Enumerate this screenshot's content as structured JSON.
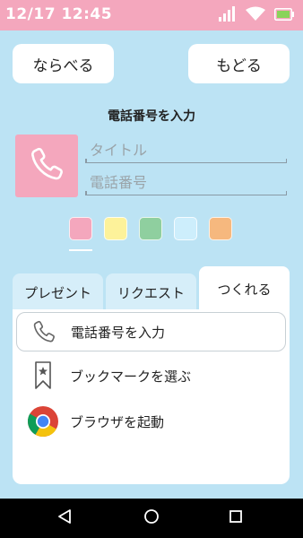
{
  "status": {
    "time": "12/17 12:45"
  },
  "header": {
    "sort_label": "ならべる",
    "back_label": "もどる"
  },
  "section": {
    "title": "電話番号を入力"
  },
  "form": {
    "title_placeholder": "タイトル",
    "title_value": "",
    "phone_placeholder": "電話番号",
    "phone_value": ""
  },
  "colors": {
    "status_bar": "#f4a7bd",
    "background": "#bce3f4",
    "swatches": [
      "#f4a7bd",
      "#fdf29a",
      "#8fcf9f",
      "#cdeefc",
      "#f6b87e"
    ],
    "selected_swatch": 0
  },
  "tabs": [
    {
      "label": "プレゼント"
    },
    {
      "label": "リクエスト"
    },
    {
      "label": "つくれる"
    }
  ],
  "active_tab": 2,
  "menu": [
    {
      "label": "電話番号を入力",
      "icon": "phone-icon"
    },
    {
      "label": "ブックマークを選ぶ",
      "icon": "bookmark-icon"
    },
    {
      "label": "ブラウザを起動",
      "icon": "chrome-icon"
    }
  ]
}
